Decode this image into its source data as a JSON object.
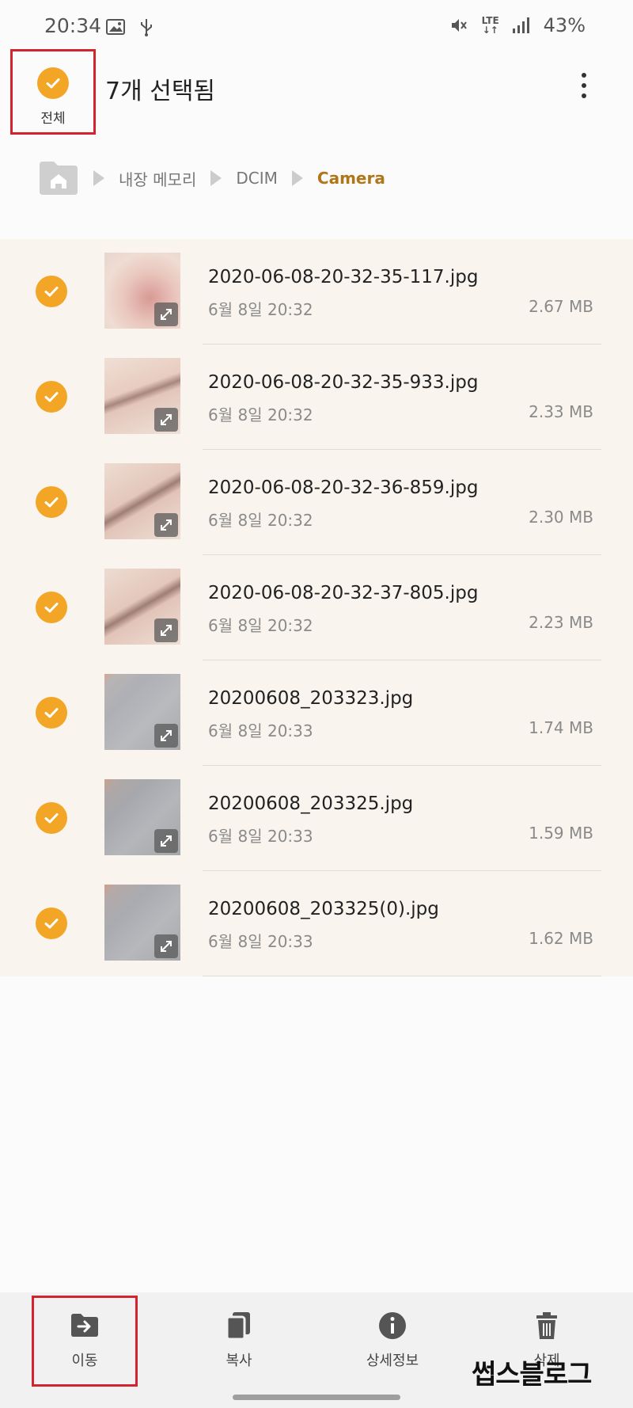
{
  "status_bar": {
    "time": "20:34",
    "left_icons": [
      "gallery-icon",
      "usb-icon"
    ],
    "right_icons": [
      "mute-icon",
      "lte-icon",
      "signal-icon"
    ],
    "network": "LTE",
    "battery": "43%"
  },
  "app_bar": {
    "select_all_label": "전체",
    "title": "7개 선택됨",
    "more_icon": "more-vert-icon"
  },
  "breadcrumb": {
    "home_icon": "folder-home-icon",
    "items": [
      "내장 메모리",
      "DCIM",
      "Camera"
    ]
  },
  "files": [
    {
      "name": "2020-06-08-20-32-35-117.jpg",
      "date": "6월 8일 20:32",
      "size": "2.67 MB",
      "selected": true
    },
    {
      "name": "2020-06-08-20-32-35-933.jpg",
      "date": "6월 8일 20:32",
      "size": "2.33 MB",
      "selected": true
    },
    {
      "name": "2020-06-08-20-32-36-859.jpg",
      "date": "6월 8일 20:32",
      "size": "2.30 MB",
      "selected": true
    },
    {
      "name": "2020-06-08-20-32-37-805.jpg",
      "date": "6월 8일 20:32",
      "size": "2.23 MB",
      "selected": true
    },
    {
      "name": "20200608_203323.jpg",
      "date": "6월 8일 20:33",
      "size": "1.74 MB",
      "selected": true
    },
    {
      "name": "20200608_203325.jpg",
      "date": "6월 8일 20:33",
      "size": "1.59 MB",
      "selected": true
    },
    {
      "name": "20200608_203325(0).jpg",
      "date": "6월 8일 20:33",
      "size": "1.62 MB",
      "selected": true
    }
  ],
  "bottom_actions": [
    {
      "label": "이동",
      "icon": "move-folder-icon"
    },
    {
      "label": "복사",
      "icon": "copy-icon"
    },
    {
      "label": "상세정보",
      "icon": "info-icon"
    },
    {
      "label": "삭제",
      "icon": "trash-icon"
    }
  ],
  "watermark": "썹스블로그",
  "colors": {
    "accent": "#f3a526",
    "selected_row_bg": "#f9f5ee",
    "current_crumb": "#b07718",
    "highlight_box": "#d3232e"
  }
}
